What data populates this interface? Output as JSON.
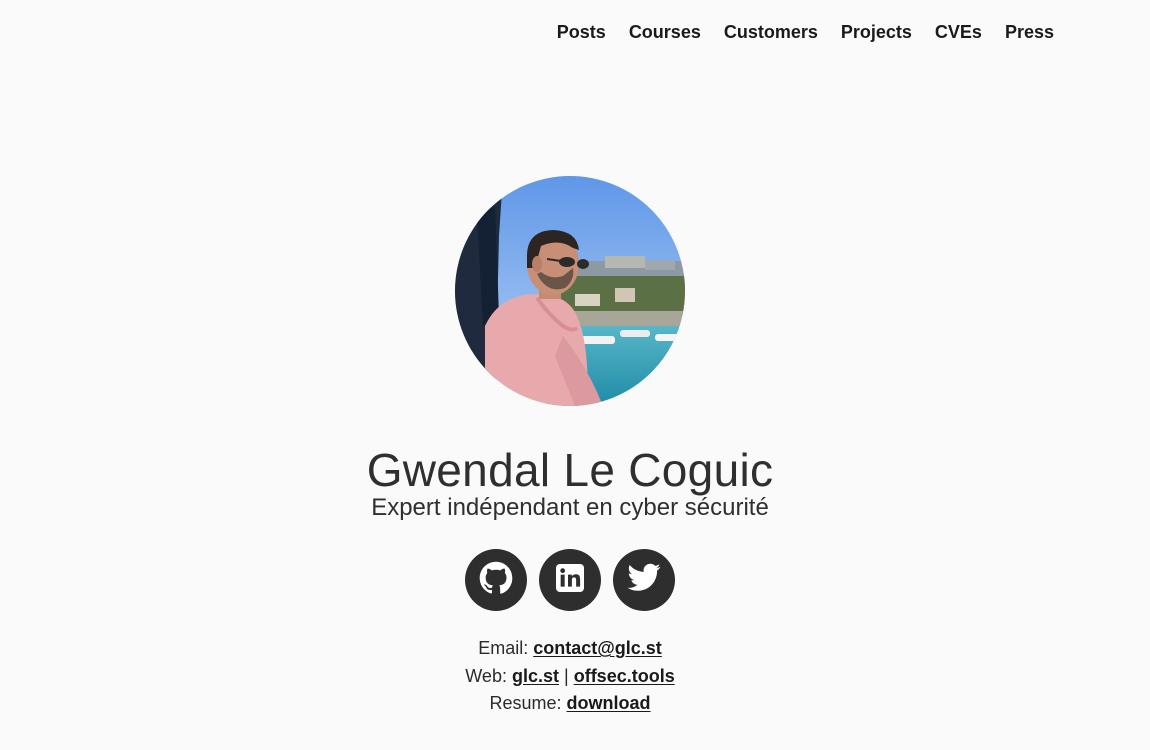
{
  "nav": {
    "items": [
      {
        "label": "Posts"
      },
      {
        "label": "Courses"
      },
      {
        "label": "Customers"
      },
      {
        "label": "Projects"
      },
      {
        "label": "CVEs"
      },
      {
        "label": "Press"
      }
    ]
  },
  "profile": {
    "name": "Gwendal Le Coguic",
    "tagline": "Expert indépendant en cyber sécurité"
  },
  "socials": [
    {
      "icon": "github-icon"
    },
    {
      "icon": "linkedin-icon"
    },
    {
      "icon": "twitter-icon"
    }
  ],
  "contact": {
    "email_label": "Email:",
    "email_value": "contact@glc.st",
    "web_label": "Web:",
    "web_link1": "glc.st",
    "web_separator": "|",
    "web_link2": "offsec.tools",
    "resume_label": "Resume:",
    "resume_link": "download"
  },
  "colors": {
    "background": "#fafafa",
    "text": "#2b2b2b",
    "icon_circle": "#2e2e2e"
  }
}
